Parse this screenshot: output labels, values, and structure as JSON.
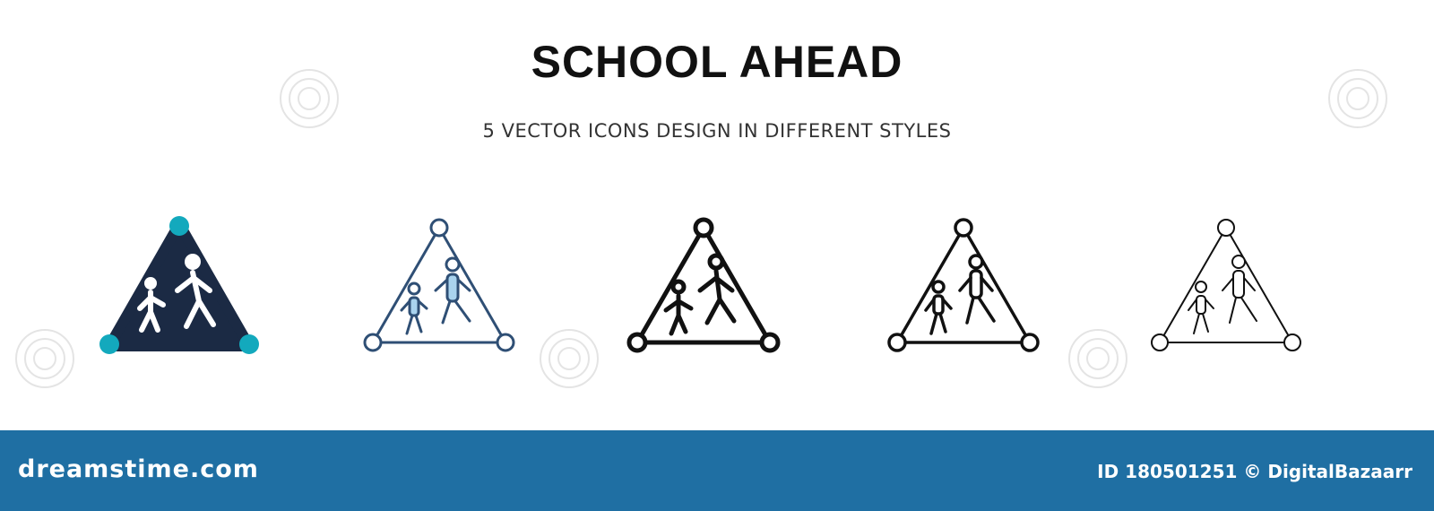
{
  "title": "SCHOOL AHEAD",
  "subtitle": "5 VECTOR ICONS DESIGN IN DIFFERENT STYLES",
  "icons": [
    {
      "name": "school-ahead-glyph-icon",
      "style": "filled"
    },
    {
      "name": "school-ahead-filled-outline-icon",
      "style": "filled-outline"
    },
    {
      "name": "school-ahead-thick-line-icon",
      "style": "thick-line"
    },
    {
      "name": "school-ahead-line-icon",
      "style": "line"
    },
    {
      "name": "school-ahead-thin-line-icon",
      "style": "thin-line"
    }
  ],
  "colors": {
    "navy": "#1b2a44",
    "teal": "#13a9bd",
    "outline_blue": "#2f4f75",
    "light_fill": "#a9d3ee",
    "footer": "#1f6fa3"
  },
  "footer": {
    "brand": "dreamstime.com",
    "credit": "ID 180501251 © DigitalBazaarr"
  }
}
